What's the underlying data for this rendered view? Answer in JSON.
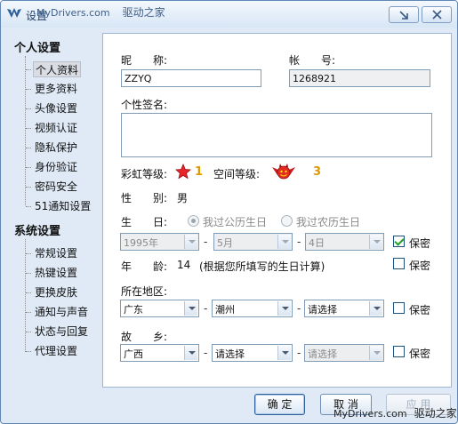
{
  "window": {
    "title": "设置"
  },
  "watermark": {
    "top_latin": "MyDrivers.com",
    "top_cn": "驱动之家",
    "bottom_latin": "MyDrivers.com",
    "bottom_cn": "驱动之家"
  },
  "sidebar": {
    "groups": [
      {
        "title": "个人设置",
        "items": [
          "个人资料",
          "更多资料",
          "头像设置",
          "视频认证",
          "隐私保护",
          "身份验证",
          "密码安全",
          "51通知设置"
        ]
      },
      {
        "title": "系统设置",
        "items": [
          "常规设置",
          "热键设置",
          "更换皮肤",
          "通知与声音",
          "状态与回复",
          "代理设置"
        ]
      }
    ],
    "selected": "个人资料"
  },
  "form": {
    "nickname_label": "昵　　称:",
    "nickname_value": "ZZYQ",
    "account_label": "帐　　号:",
    "account_value": "1268921",
    "signature_label": "个性签名:",
    "rainbow_label": "彩虹等级:",
    "rainbow_value": "1",
    "space_label": "空间等级:",
    "space_value": "3",
    "gender_label": "性　　别:",
    "gender_value": "男",
    "birthday_label": "生　　日:",
    "birthday_solar": "我过公历生日",
    "birthday_lunar": "我过农历生日",
    "birthday_solar_selected": true,
    "birth_year": "1995年",
    "birth_month": "5月",
    "birth_day": "4日",
    "birthday_private": true,
    "age_label": "年　　龄:",
    "age_value": "14",
    "age_note": "(根据您所填写的生日计算)",
    "age_private": false,
    "region_label": "所在地区:",
    "region_1": "广东",
    "region_2": "潮州",
    "region_3": "请选择",
    "region_private": false,
    "hometown_label": "故　　乡:",
    "hometown_1": "广西",
    "hometown_2": "请选择",
    "hometown_3": "请选择",
    "hometown_private": false,
    "private_label": "保密",
    "dash": "-"
  },
  "buttons": {
    "ok": "确 定",
    "cancel": "取 消",
    "apply": "应 用"
  },
  "colors": {
    "accent": "#5f87b5",
    "level": "#e09a00",
    "check": "#21a121"
  }
}
